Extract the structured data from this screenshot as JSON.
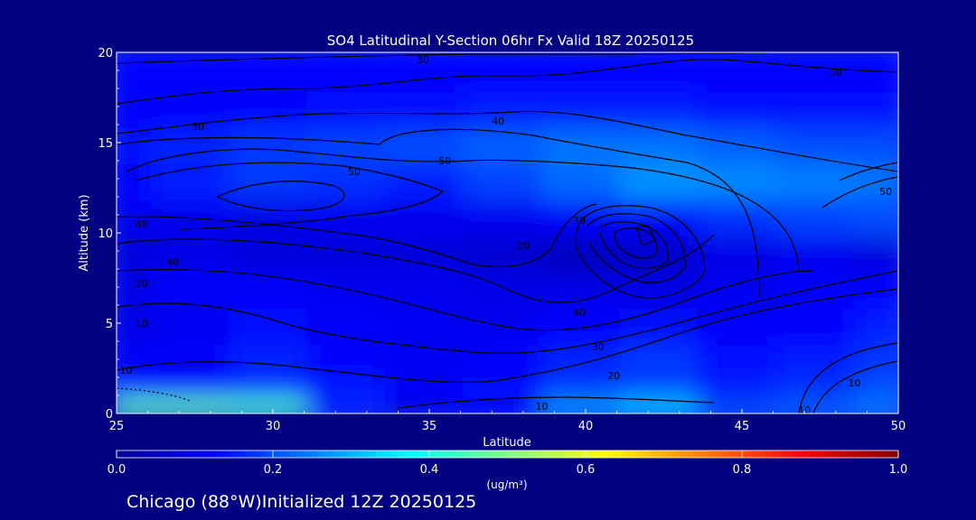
{
  "title": "SO4 Latitudinal Y-Section 06hr  Fx Valid 18Z 20250125",
  "footer": "Chicago (88°W)Initialized 12Z 20250125",
  "chart_data": {
    "type": "heatmap",
    "title": "SO4 Latitudinal Y-Section 06hr  Fx Valid 18Z 20250125",
    "xlabel": "Latitude",
    "ylabel": "Altitude (km)",
    "xlim": [
      25,
      50
    ],
    "ylim": [
      0,
      20
    ],
    "xticks": [
      25,
      30,
      35,
      40,
      45,
      50
    ],
    "yticks": [
      0,
      5,
      10,
      15,
      20
    ],
    "colorbar": {
      "unit_label": "(ug/m³)",
      "range": [
        0.0,
        1.0
      ],
      "ticks": [
        "0.0",
        "0.2",
        "0.4",
        "0.6",
        "0.8",
        "1.0"
      ],
      "colormap": "jet"
    },
    "field": {
      "x": [
        25,
        27.5,
        30,
        32.5,
        35,
        37.5,
        40,
        42.5,
        45,
        47.5,
        50
      ],
      "y": [
        0.5,
        1.5,
        3,
        5,
        7,
        9,
        11,
        13,
        15,
        17,
        19
      ],
      "values": [
        [
          0.47,
          0.47,
          0.45,
          0.15,
          0.1,
          0.12,
          0.28,
          0.33,
          0.2,
          0.22,
          0.25
        ],
        [
          0.15,
          0.14,
          0.17,
          0.15,
          0.12,
          0.14,
          0.18,
          0.19,
          0.15,
          0.17,
          0.2
        ],
        [
          0.12,
          0.12,
          0.16,
          0.13,
          0.11,
          0.12,
          0.16,
          0.18,
          0.14,
          0.15,
          0.18
        ],
        [
          0.1,
          0.11,
          0.14,
          0.12,
          0.11,
          0.11,
          0.13,
          0.14,
          0.13,
          0.13,
          0.15
        ],
        [
          0.1,
          0.12,
          0.12,
          0.11,
          0.11,
          0.1,
          0.1,
          0.1,
          0.11,
          0.12,
          0.13
        ],
        [
          0.09,
          0.1,
          0.09,
          0.09,
          0.09,
          0.08,
          0.06,
          0.07,
          0.1,
          0.11,
          0.09
        ],
        [
          0.11,
          0.11,
          0.1,
          0.11,
          0.11,
          0.11,
          0.12,
          0.13,
          0.17,
          0.19,
          0.2
        ],
        [
          0.13,
          0.15,
          0.18,
          0.17,
          0.15,
          0.19,
          0.23,
          0.27,
          0.26,
          0.25,
          0.24
        ],
        [
          0.14,
          0.16,
          0.18,
          0.19,
          0.2,
          0.22,
          0.24,
          0.24,
          0.22,
          0.2,
          0.2
        ],
        [
          0.13,
          0.13,
          0.13,
          0.14,
          0.14,
          0.15,
          0.15,
          0.15,
          0.14,
          0.14,
          0.14
        ],
        [
          0.13,
          0.13,
          0.13,
          0.13,
          0.13,
          0.13,
          0.13,
          0.13,
          0.13,
          0.13,
          0.13
        ]
      ]
    },
    "contour_labels": [
      {
        "text": "30",
        "x": 27.6,
        "y": 15.9
      },
      {
        "text": "30",
        "x": 34.8,
        "y": 19.6
      },
      {
        "text": "30",
        "x": 48.0,
        "y": 18.9
      },
      {
        "text": "40",
        "x": 37.2,
        "y": 16.2
      },
      {
        "text": "50",
        "x": 32.6,
        "y": 13.4
      },
      {
        "text": "50",
        "x": 35.5,
        "y": 14.0
      },
      {
        "text": "40",
        "x": 25.8,
        "y": 10.5
      },
      {
        "text": "40",
        "x": 26.8,
        "y": 8.4
      },
      {
        "text": "30",
        "x": 39.8,
        "y": 10.7
      },
      {
        "text": "20",
        "x": 38.0,
        "y": 9.3
      },
      {
        "text": "20",
        "x": 25.8,
        "y": 7.2
      },
      {
        "text": "10",
        "x": 25.8,
        "y": 5.0
      },
      {
        "text": "10",
        "x": 25.3,
        "y": 2.4
      },
      {
        "text": "40",
        "x": 39.8,
        "y": 5.6
      },
      {
        "text": "30",
        "x": 40.4,
        "y": 3.7
      },
      {
        "text": "20",
        "x": 40.9,
        "y": 2.1
      },
      {
        "text": "10",
        "x": 38.6,
        "y": 0.4
      },
      {
        "text": "10",
        "x": 47.0,
        "y": 0.2
      },
      {
        "text": "10",
        "x": 48.6,
        "y": 1.7
      },
      {
        "text": "50",
        "x": 49.6,
        "y": 12.3
      }
    ]
  }
}
